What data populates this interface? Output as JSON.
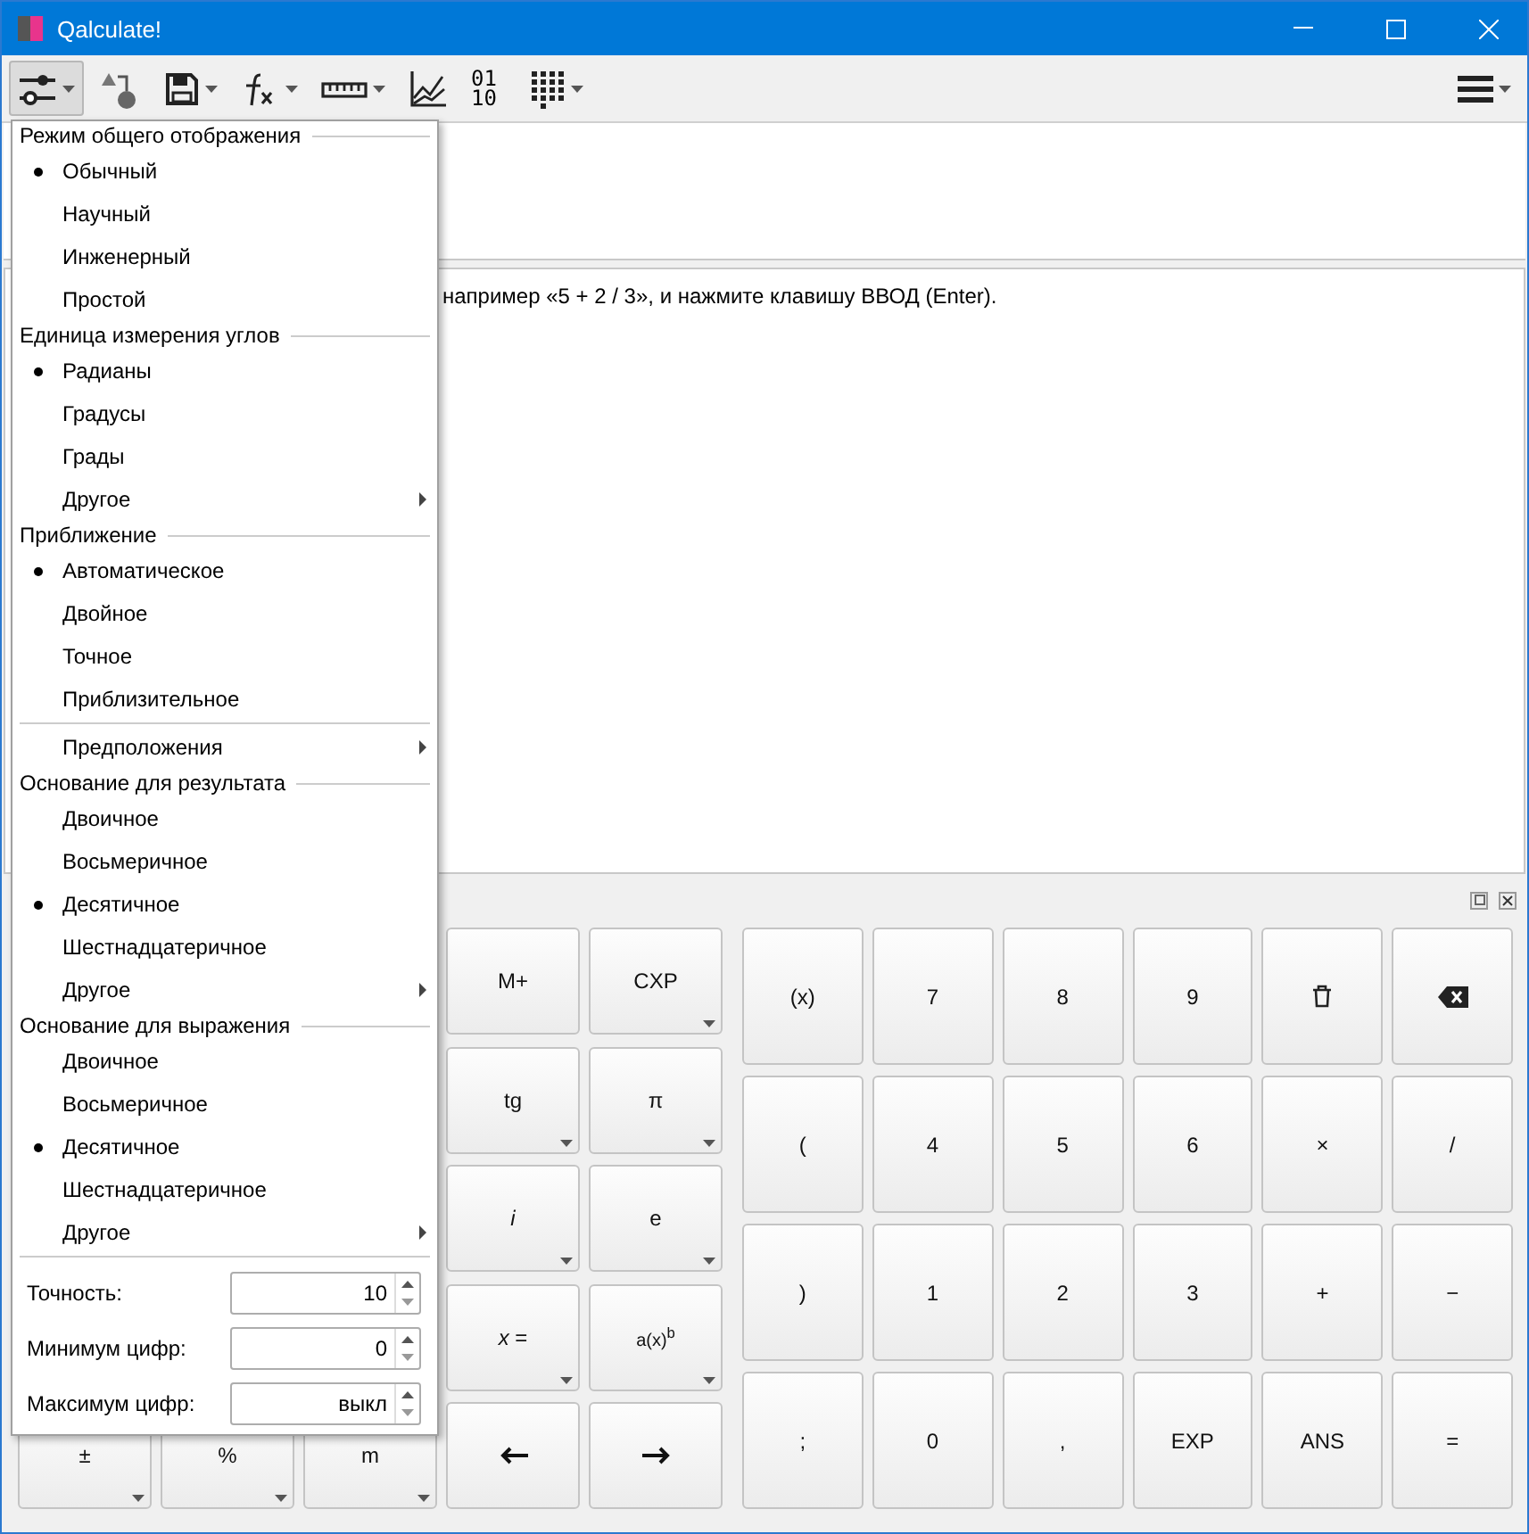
{
  "window": {
    "title": "Qalculate!"
  },
  "toolbar": {
    "buttons": [
      {
        "kind": "mode",
        "pressed": true,
        "has_menu": true
      },
      {
        "kind": "convert",
        "pressed": false,
        "has_menu": false
      },
      {
        "kind": "save",
        "pressed": false,
        "has_menu": true
      },
      {
        "kind": "function",
        "pressed": false,
        "has_menu": true
      },
      {
        "kind": "unit",
        "pressed": false,
        "has_menu": true
      },
      {
        "kind": "plot",
        "pressed": false,
        "has_menu": false
      },
      {
        "kind": "base",
        "pressed": false,
        "has_menu": false,
        "lines": [
          "01",
          "10"
        ]
      },
      {
        "kind": "keypad",
        "pressed": false,
        "has_menu": true
      }
    ],
    "menu_button": {
      "has_menu": true
    }
  },
  "history": {
    "hint": "например «5 + 2 / 3», и нажмите клавишу ВВОД (Enter)."
  },
  "mode_menu": {
    "sections": [
      {
        "kind": "group",
        "title": "Режим общего отображения",
        "items": [
          {
            "label": "Обычный",
            "selected": true,
            "submenu": false
          },
          {
            "label": "Научный",
            "selected": false,
            "submenu": false
          },
          {
            "label": "Инженерный",
            "selected": false,
            "submenu": false
          },
          {
            "label": "Простой",
            "selected": false,
            "submenu": false
          }
        ]
      },
      {
        "kind": "group",
        "title": "Единица измерения углов",
        "items": [
          {
            "label": "Радианы",
            "selected": true,
            "submenu": false
          },
          {
            "label": "Градусы",
            "selected": false,
            "submenu": false
          },
          {
            "label": "Грады",
            "selected": false,
            "submenu": false
          },
          {
            "label": "Другое",
            "selected": false,
            "submenu": true
          }
        ]
      },
      {
        "kind": "group",
        "title": "Приближение",
        "items": [
          {
            "label": "Автоматическое",
            "selected": true,
            "submenu": false
          },
          {
            "label": "Двойное",
            "selected": false,
            "submenu": false
          },
          {
            "label": "Точное",
            "selected": false,
            "submenu": false
          },
          {
            "label": "Приблизительное",
            "selected": false,
            "submenu": false
          }
        ]
      },
      {
        "kind": "plain",
        "items": [
          {
            "label": "Предположения",
            "selected": false,
            "submenu": true
          }
        ]
      },
      {
        "kind": "group",
        "title": "Основание для результата",
        "items": [
          {
            "label": "Двоичное",
            "selected": false,
            "submenu": false
          },
          {
            "label": "Восьмеричное",
            "selected": false,
            "submenu": false
          },
          {
            "label": "Десятичное",
            "selected": true,
            "submenu": false
          },
          {
            "label": "Шестнадцатеричное",
            "selected": false,
            "submenu": false
          },
          {
            "label": "Другое",
            "selected": false,
            "submenu": true
          }
        ]
      },
      {
        "kind": "group",
        "title": "Основание для выражения",
        "items": [
          {
            "label": "Двоичное",
            "selected": false,
            "submenu": false
          },
          {
            "label": "Восьмеричное",
            "selected": false,
            "submenu": false
          },
          {
            "label": "Десятичное",
            "selected": true,
            "submenu": false
          },
          {
            "label": "Шестнадцатеричное",
            "selected": false,
            "submenu": false
          },
          {
            "label": "Другое",
            "selected": false,
            "submenu": true
          }
        ]
      }
    ],
    "fields": [
      {
        "label": "Точность:",
        "value": "10"
      },
      {
        "label": "Минимум цифр:",
        "value": "0"
      },
      {
        "label": "Максимум цифр:",
        "value": "выкл"
      }
    ]
  },
  "keypad": {
    "left_grid": [
      {
        "label": "M+",
        "has_menu": false
      },
      {
        "label": "CXP",
        "has_menu": true
      },
      {
        "label": "tg",
        "has_menu": true
      },
      {
        "label": "π",
        "has_menu": true
      },
      {
        "label": "*i*",
        "has_menu": true
      },
      {
        "label": "e",
        "has_menu": true
      },
      {
        "label": "*x* =",
        "has_menu": true
      },
      {
        "label": "a(x)$^{b}$",
        "has_menu": true
      },
      {
        "kind": "left",
        "has_menu": false
      },
      {
        "kind": "right",
        "has_menu": false
      }
    ],
    "bottom_row": [
      {
        "label": "±",
        "has_menu": true
      },
      {
        "label": "%",
        "has_menu": true
      },
      {
        "label": "m",
        "has_menu": true
      }
    ],
    "main": [
      {
        "label": "(x)"
      },
      {
        "label": "7"
      },
      {
        "label": "8"
      },
      {
        "label": "9"
      },
      {
        "kind": "clear"
      },
      {
        "kind": "backspace"
      },
      {
        "label": "("
      },
      {
        "label": "4"
      },
      {
        "label": "5"
      },
      {
        "label": "6"
      },
      {
        "label": "×"
      },
      {
        "label": "/"
      },
      {
        "label": ")"
      },
      {
        "label": "1"
      },
      {
        "label": "2"
      },
      {
        "label": "3"
      },
      {
        "label": "+"
      },
      {
        "label": "−"
      },
      {
        "label": ";"
      },
      {
        "label": "0"
      },
      {
        "label": ","
      },
      {
        "label": "EXP"
      },
      {
        "label": "ANS"
      },
      {
        "label": "="
      }
    ]
  }
}
